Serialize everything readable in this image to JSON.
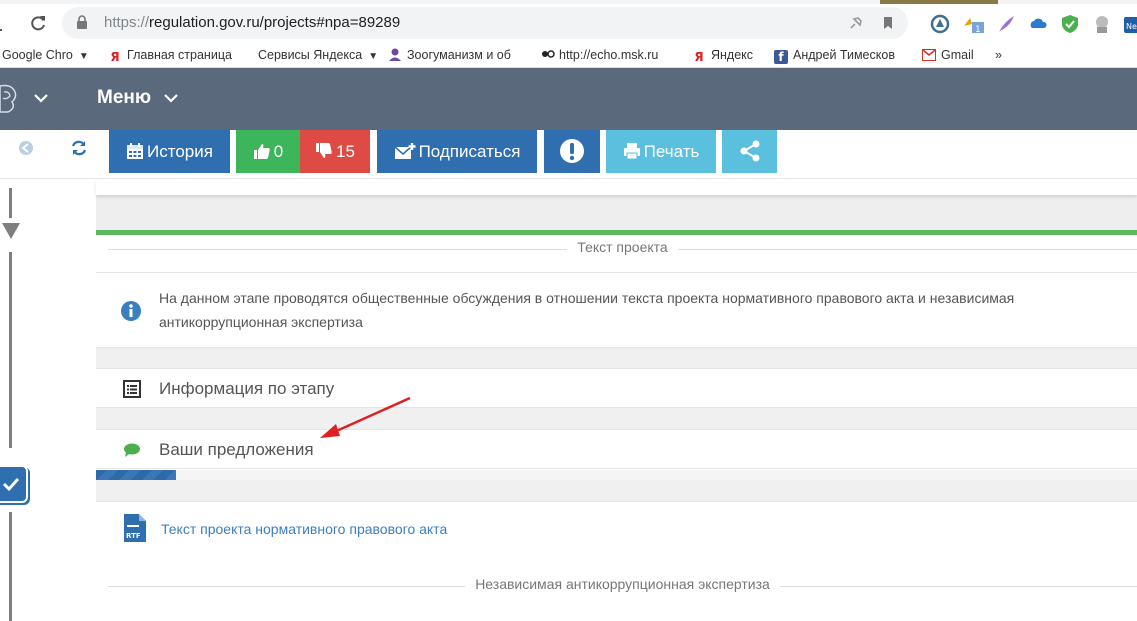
{
  "browser": {
    "url_protocol": "https://",
    "url_rest": "regulation.gov.ru/projects#npa=89289",
    "bookmarks": [
      {
        "label": "Google Chro",
        "icon": "google-chrome-icon",
        "has_dropdown": true
      },
      {
        "label": "Главная страница",
        "icon": "yandex-icon"
      },
      {
        "label": "Сервисы Яндекса",
        "icon": "",
        "has_dropdown": true
      },
      {
        "label": "Зоогуманизм и об",
        "icon": "user-icon"
      },
      {
        "label": "http://echo.msk.ru",
        "icon": "echo-icon"
      },
      {
        "label": "Яндекс",
        "icon": "yandex-icon"
      },
      {
        "label": "Андрей Тимесков",
        "icon": "facebook-icon"
      },
      {
        "label": "Gmail",
        "icon": "gmail-icon"
      }
    ],
    "more_bookmarks": "»"
  },
  "header": {
    "menu_label": "Меню"
  },
  "toolbar": {
    "history_label": "История",
    "likes_count": "0",
    "dislikes_count": "15",
    "subscribe_label": "Подписаться",
    "print_label": "Печать"
  },
  "panel": {
    "section_title": "Текст проекта",
    "info_text": "На данном этапе проводятся общественные обсуждения в отношении текста проекта нормативного правового акта и независимая антикоррупционная экспертиза",
    "stage_info_label": "Информация по этапу",
    "proposals_label": "Ваши предложения",
    "progress_fraction": 0.077,
    "document_link": "Текст проекта нормативного правового акта",
    "expertise_title": "Независимая антикоррупционная экспертиза"
  },
  "colors": {
    "header_bg": "#5a6a7c",
    "primary_blue": "#2f6fb0",
    "like_green": "#3cb55b",
    "dislike_red": "#de4b45",
    "info_cyan": "#5bc0de",
    "panel_accent": "#5cb85c",
    "annotation_arrow": "#e02020"
  }
}
